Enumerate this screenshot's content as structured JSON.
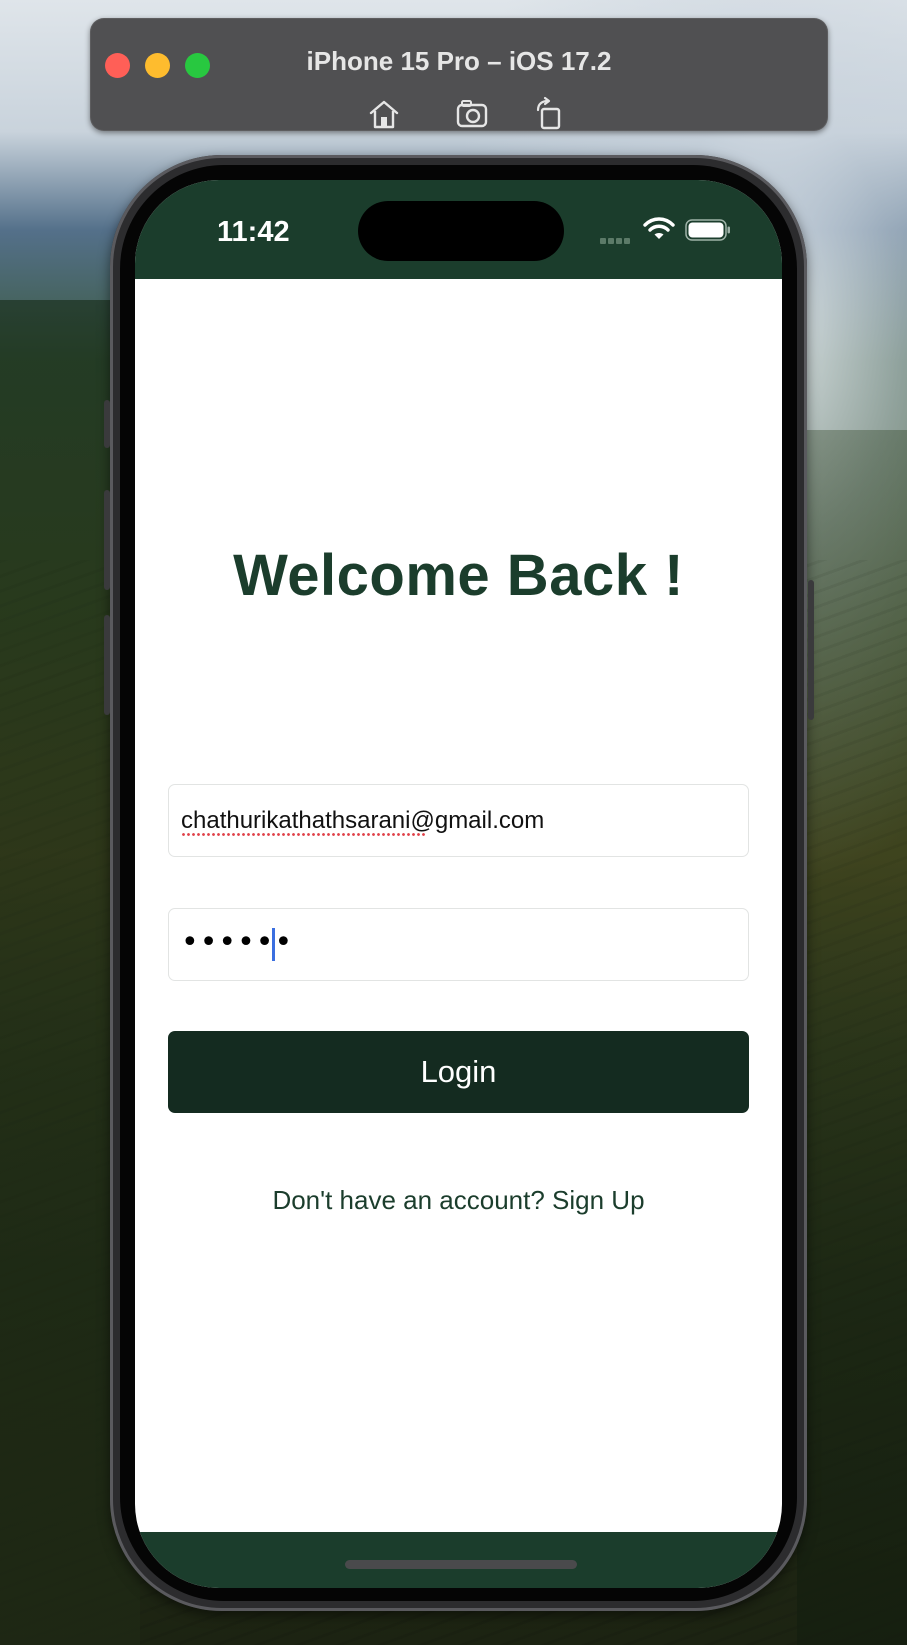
{
  "simulator": {
    "title": "iPhone 15 Pro – iOS 17.2",
    "tools": [
      "home-icon",
      "screenshot-icon",
      "rotate-icon"
    ]
  },
  "status_bar": {
    "time": "11:42"
  },
  "login": {
    "heading": "Welcome Back !",
    "email_value": "chathurikathathsarani@gmail.com",
    "password_mask": "••••••",
    "button_label": "Login",
    "signup_text": "Don't have an account? Sign Up"
  },
  "colors": {
    "brand_dark_green": "#1b3d2c",
    "button_green": "#142b20",
    "spell_underline": "#e0424a",
    "caret": "#3b6fe0"
  }
}
